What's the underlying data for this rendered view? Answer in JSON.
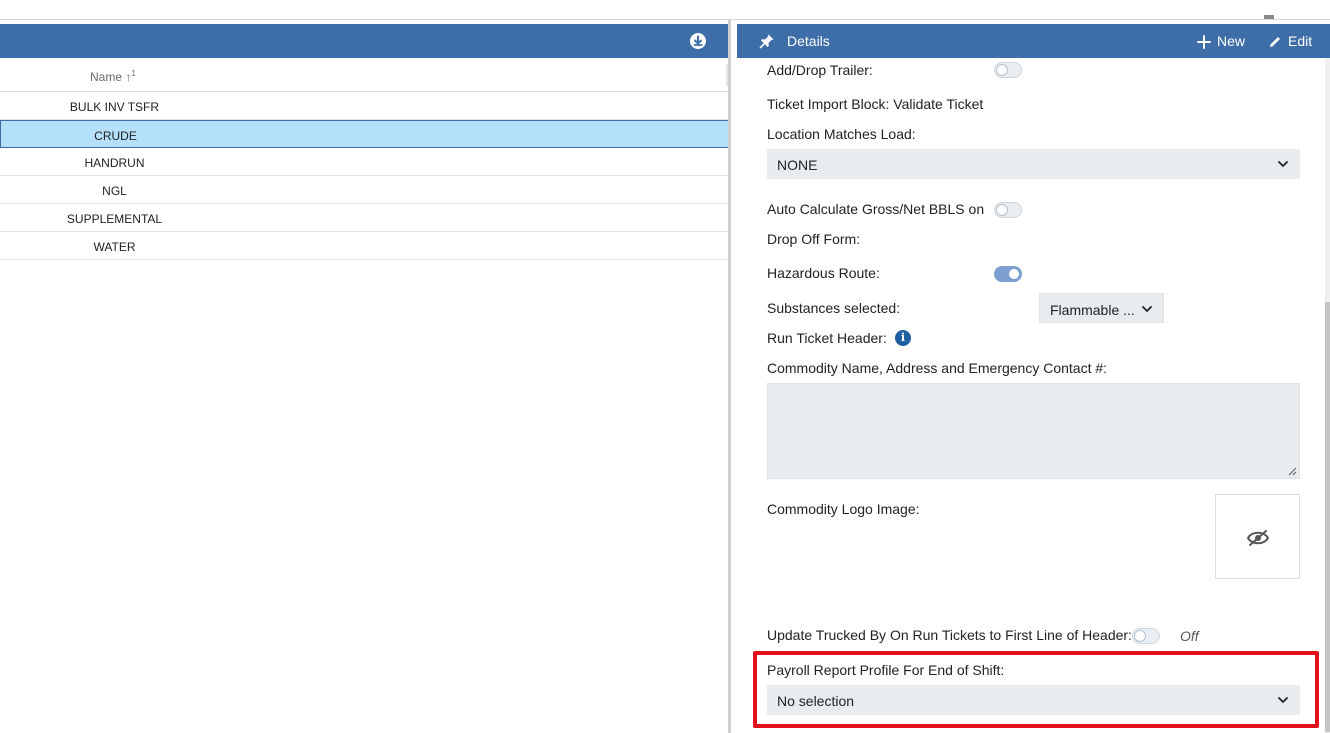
{
  "grid": {
    "column_header": "Name",
    "sort_indicator": "↑",
    "sort_order": "1",
    "rows": [
      "BULK INV TSFR",
      "CRUDE",
      "HANDRUN",
      "NGL",
      "SUPPLEMENTAL",
      "WATER"
    ],
    "selected_row": "CRUDE",
    "download_icon": "download-icon"
  },
  "details": {
    "title": "Details",
    "pin_icon": "pin-icon",
    "new_label": "New",
    "edit_label": "Edit",
    "add_drop_trailer_label": "Add/Drop Trailer:",
    "ticket_import_label": "Ticket Import Block: Validate Ticket",
    "location_matches_label": "Location Matches Load:",
    "location_matches_value": "NONE",
    "auto_calc_label_1": "Auto Calculate Gross/Net BBLS on",
    "auto_calc_label_2": "Drop Off Form:",
    "hazardous_label": "Hazardous Route:",
    "substances_label": "Substances selected:",
    "substances_value": "Flammable ...",
    "run_ticket_label": "Run Ticket Header:",
    "info_glyph": "i",
    "commodity_contact_label": "Commodity Name, Address and Emergency Contact #:",
    "commodity_contact_value": "",
    "logo_label": "Commodity Logo Image:",
    "update_trucked_label": "Update Trucked By On Run Tickets to First Line of Header:",
    "update_trucked_state": "Off",
    "payroll_label": "Payroll Report Profile For End of Shift:",
    "payroll_value": "No selection",
    "toggles": {
      "add_drop_trailer": false,
      "auto_calculate": false,
      "hazardous_route": true,
      "update_trucked": false
    }
  },
  "colors": {
    "header_blue": "#3d6ea8",
    "selected_row": "#b5e0fb",
    "highlight_red": "#e2101a"
  }
}
